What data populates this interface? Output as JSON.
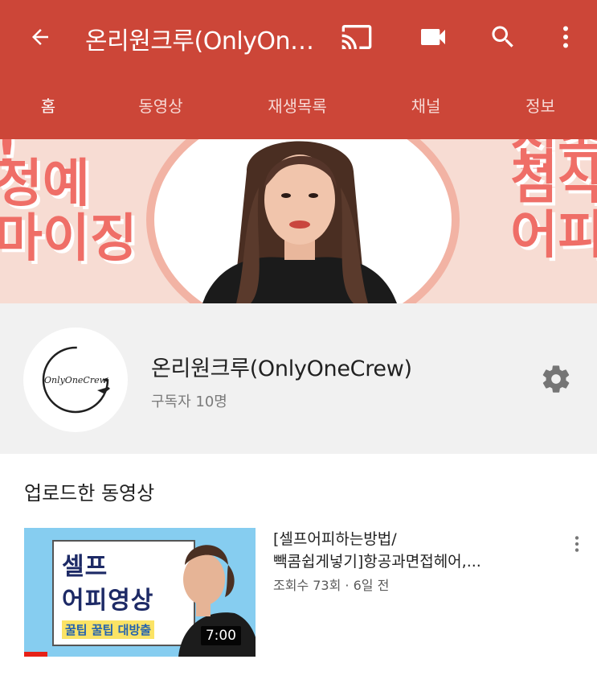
{
  "header": {
    "title": "온리원크루(OnlyOneCrew)",
    "actions": [
      "cast-icon",
      "video-camera-icon",
      "search-icon",
      "more-vert-icon"
    ]
  },
  "tabs": [
    {
      "label": "홈",
      "active": true
    },
    {
      "label": "동영상",
      "active": false
    },
    {
      "label": "재생목록",
      "active": false
    },
    {
      "label": "채널",
      "active": false
    },
    {
      "label": "정보",
      "active": false
    }
  ],
  "banner": {
    "left_text": [
      "!",
      "정예",
      "마이징"
    ],
    "right_text": [
      "접속",
      "첨삭",
      "어피"
    ]
  },
  "channel": {
    "name": "온리원크루(OnlyOneCrew)",
    "subscribers": "구독자 10명",
    "logo_text": "OnlyOneCrew"
  },
  "uploads": {
    "section_title": "업로드한 동영상",
    "videos": [
      {
        "title_line1": "[셀프어피하는방법/",
        "title_line2": "빽콤쉽게넣기]항공과면접헤어,...",
        "meta": "조회수 73회 · 6일 전",
        "duration": "7:00",
        "thumb_line1": "셀프",
        "thumb_line2": "어피영상",
        "thumb_line3": "꿀팁 꿀팁 대방출",
        "progress": 0.1
      }
    ]
  },
  "colors": {
    "appbar": "#cc4638",
    "banner_text": "#ef6e67",
    "progress": "#e62117"
  }
}
